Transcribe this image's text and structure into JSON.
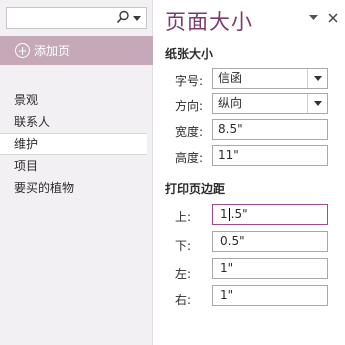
{
  "left": {
    "search": {
      "icon": "search-icon",
      "dropdown_icon": "chevron-down-icon"
    },
    "add_page_label": "添加页",
    "pages": [
      {
        "label": "景观",
        "selected": false
      },
      {
        "label": "联系人",
        "selected": false
      },
      {
        "label": "维护",
        "selected": true
      },
      {
        "label": "项目",
        "selected": false
      },
      {
        "label": "要买的植物",
        "selected": false
      }
    ]
  },
  "pane": {
    "title": "页面大小",
    "menu_icon": "chevron-down-icon",
    "close_icon": "close-icon",
    "paper_size": {
      "heading": "纸张大小",
      "size_label": "字号:",
      "size_value": "信函",
      "orientation_label": "方向:",
      "orientation_value": "纵向",
      "width_label": "宽度:",
      "width_value": "8.5\"",
      "height_label": "高度:",
      "height_value": "11\""
    },
    "margins": {
      "heading": "打印页边距",
      "top_label": "上:",
      "top_value_before_caret": "1",
      "top_value_after_caret": ".5\"",
      "bottom_label": "下:",
      "bottom_value": "0.5\"",
      "left_label": "左:",
      "left_value": "1\"",
      "right_label": "右:",
      "right_value": "1\""
    }
  },
  "colors": {
    "accent": "#7a3c70",
    "add_page_bg": "#c5a9b9",
    "left_bg": "#f2f0f3",
    "focus_border": "#a04a8e"
  }
}
